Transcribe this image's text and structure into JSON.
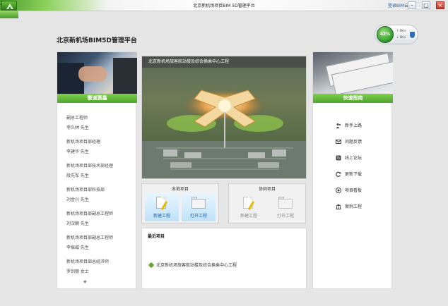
{
  "window": {
    "title": "北京新机场项目BIM 5D管理平台",
    "login_text": "登录BIM云",
    "controls": [
      "–",
      "□",
      "×"
    ]
  },
  "app": {
    "title": "北京新机场BIM5D管理平台"
  },
  "perf": {
    "percent": "42%",
    "line1": "0K/s",
    "line2": "0K/s"
  },
  "left": {
    "header": "寰诚惠鑫",
    "contacts": [
      {
        "role": "副总工程师",
        "name": "李久林  先生"
      },
      {
        "role": "新机场项目部经理",
        "name": "李建华  先生"
      },
      {
        "role": "新机场项目部技术部经理",
        "name": "段先军  先生"
      },
      {
        "role": "新机场项目部科技部",
        "name": "刘金兴  先生"
      },
      {
        "role": "新机场项目部副总工程师",
        "name": "刘汉朝  先生"
      },
      {
        "role": "新机场项目部副总工程师",
        "name": "李振威  先生"
      },
      {
        "role": "新机场项目部总经济师",
        "name": "罗剑丽  女士"
      }
    ],
    "more": "◆"
  },
  "hero": {
    "caption": "北京新机场旅客航站楼及综合换乘中心工程"
  },
  "local_projects": {
    "title": "本地项目",
    "new_label": "新建工程",
    "open_label": "打开工程"
  },
  "collab_projects": {
    "title": "协同项目",
    "new_label": "新建工程",
    "open_label": "打开工程"
  },
  "recent": {
    "title": "最近项目",
    "items": [
      "北京新机场旅客航站楼及综合换乘中心工程"
    ]
  },
  "right": {
    "header": "快速指南",
    "guides": [
      {
        "icon": "users-icon",
        "label": "新手上路"
      },
      {
        "icon": "mail-icon",
        "label": "问题反馈"
      },
      {
        "icon": "forum-icon",
        "label": "线上论坛"
      },
      {
        "icon": "refresh-icon",
        "label": "更新下载"
      },
      {
        "icon": "project-board-icon",
        "label": "项目看板"
      },
      {
        "icon": "building-icon",
        "label": "案例工程"
      }
    ]
  }
}
